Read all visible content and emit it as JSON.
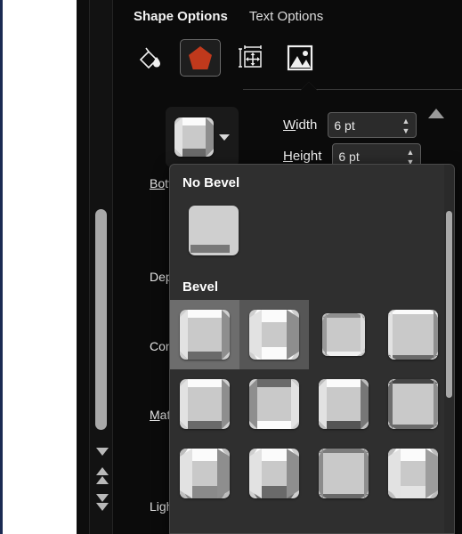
{
  "pane": {
    "tabs": [
      {
        "label": "Shape Options",
        "active": true
      },
      {
        "label": "Text Options",
        "active": false
      }
    ],
    "icons": [
      {
        "name": "fill-line-icon",
        "label": "Fill & Line"
      },
      {
        "name": "effects-pentagon-icon",
        "label": "Effects"
      },
      {
        "name": "size-properties-icon",
        "label": "Size & Properties"
      },
      {
        "name": "picture-icon",
        "label": "Picture"
      }
    ]
  },
  "bevel_control": {
    "button_name": "Bevel",
    "width": {
      "label": "Width",
      "accel": "W",
      "value": "6 pt"
    },
    "height": {
      "label": "Height",
      "accel": "H",
      "value": "6 pt"
    }
  },
  "background_labels": [
    {
      "text": "Bottom bevel",
      "short": "Bo",
      "accel": "B"
    },
    {
      "text": "Depth",
      "short": "D",
      "accel": ""
    },
    {
      "text": "Contour",
      "short": "Co",
      "accel": ""
    },
    {
      "text": "Material",
      "short": "M",
      "accel": "M"
    },
    {
      "text": "Lighting",
      "short": "Lig",
      "accel": ""
    }
  ],
  "gallery": {
    "sections": [
      {
        "heading": "No Bevel",
        "items": [
          {
            "name": "No Bevel",
            "style": "none",
            "state": "normal"
          }
        ]
      },
      {
        "heading": "Bevel",
        "items": [
          {
            "name": "Circle",
            "style": "round",
            "state": "selected"
          },
          {
            "name": "Cross",
            "style": "cross",
            "state": "hover"
          },
          {
            "name": "Relaxed Inset",
            "style": "inset",
            "state": "normal"
          },
          {
            "name": "Angle",
            "style": "angle",
            "state": "normal"
          },
          {
            "name": "Soft Round",
            "style": "softround",
            "state": "normal"
          },
          {
            "name": "Convex",
            "style": "convex",
            "state": "normal"
          },
          {
            "name": "Slope",
            "style": "slope",
            "state": "normal"
          },
          {
            "name": "Divot",
            "style": "divot",
            "state": "normal"
          },
          {
            "name": "Riblet",
            "style": "riblet",
            "state": "normal"
          },
          {
            "name": "Hard Edge",
            "style": "hardedge",
            "state": "normal"
          },
          {
            "name": "Art Deco",
            "style": "artdeco",
            "state": "normal"
          },
          {
            "name": "Cool Slant",
            "style": "coolslant",
            "state": "normal"
          }
        ]
      }
    ]
  },
  "scrollbars": {
    "document_scroll_name": "document-vertical-scrollbar",
    "buttons": [
      {
        "name": "scroll-down-button",
        "glyph": "down"
      },
      {
        "name": "previous-page-button",
        "glyph": "double-up"
      },
      {
        "name": "next-page-button",
        "glyph": "double-down"
      }
    ]
  },
  "colors": {
    "pane_bg": "#0b0b0b",
    "gallery_bg": "#2f2f2f",
    "selected": "#6d6d6d",
    "hover": "#565656",
    "accent_shape": "#c0391c",
    "doc_edge": "#1b2a52"
  }
}
